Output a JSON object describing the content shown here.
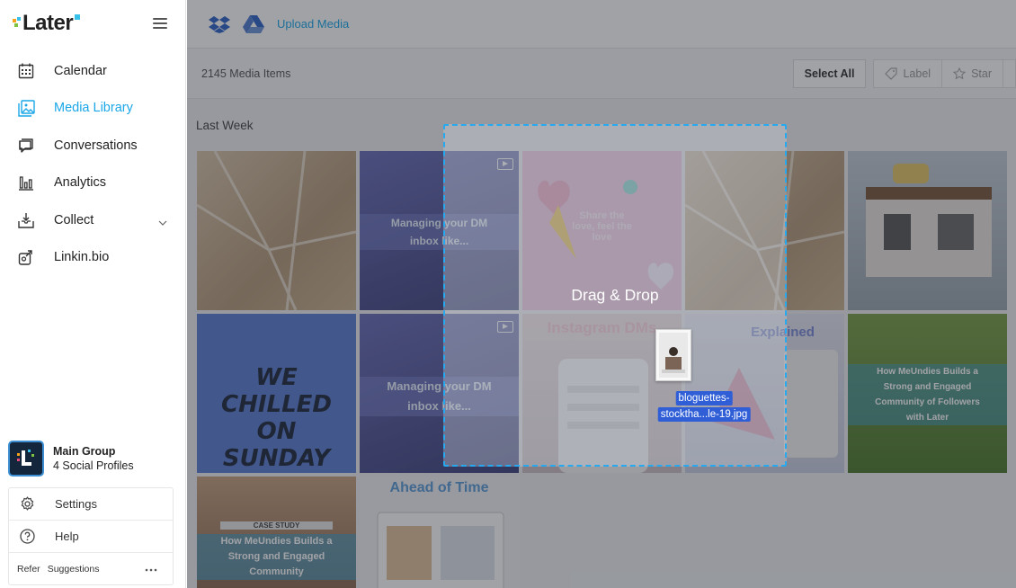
{
  "app": {
    "logo_text": "Later"
  },
  "sidebar": {
    "items": [
      {
        "label": "Calendar",
        "icon": "calendar-icon"
      },
      {
        "label": "Media Library",
        "icon": "media-icon",
        "active": true
      },
      {
        "label": "Conversations",
        "icon": "chat-icon"
      },
      {
        "label": "Analytics",
        "icon": "analytics-icon"
      },
      {
        "label": "Collect",
        "icon": "collect-icon"
      },
      {
        "label": "Linkin.bio",
        "icon": "link-icon"
      }
    ],
    "group": {
      "name": "Main Group",
      "subtitle": "4 Social Profiles"
    },
    "bottom": {
      "settings": "Settings",
      "help": "Help",
      "refer": "Refer",
      "suggestions": "Suggestions"
    }
  },
  "topbar": {
    "upload_label": "Upload Media"
  },
  "toolbar": {
    "count": "2145 Media Items",
    "select_all": "Select All",
    "label": "Label",
    "star": "Star"
  },
  "section": {
    "title": "Last Week"
  },
  "tiles": {
    "t2": "Managing your DM inbox like...",
    "t3": "Share the love, feel the love",
    "t6": "WE CHILLED ON SUNDAY",
    "t7": "Managing your DM inbox like...",
    "t8": "Instagram DMs",
    "t9": "Explained",
    "t10": "How MeUndies Builds a Strong and Engaged Community of Followers with Later",
    "t11a": "CASE STUDY",
    "t11b": "How MeUndies Builds a Strong and Engaged Community",
    "t12": "Ahead of Time"
  },
  "dropzone": {
    "title": "Drag & Drop",
    "file_line1": "bloguettes-",
    "file_line2": "stocktha...le-19.jpg"
  },
  "colors": {
    "accent": "#1aa7e8",
    "dash": "#27a9f0",
    "file_highlight": "#2f5ed6"
  }
}
